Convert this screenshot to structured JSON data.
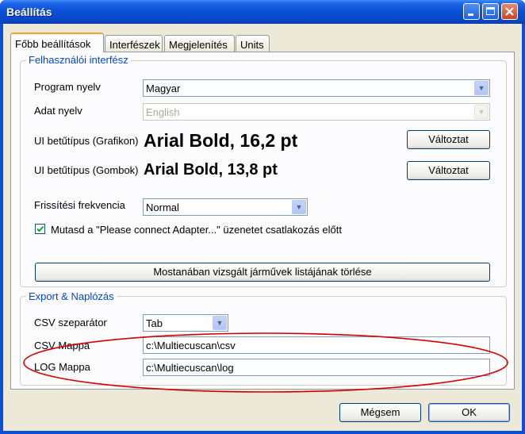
{
  "window": {
    "title": "Beállítás"
  },
  "tabs": [
    {
      "label": "Főbb beállítások",
      "active": true
    },
    {
      "label": "Interfészek",
      "active": false
    },
    {
      "label": "Megjelenítés",
      "active": false
    },
    {
      "label": "Units",
      "active": false
    }
  ],
  "ui_group": {
    "title": "Felhasználói interfész",
    "program_language": {
      "label": "Program nyelv",
      "value": "Magyar"
    },
    "data_language": {
      "label": "Adat nyelv",
      "value": "English",
      "disabled": true
    },
    "font_chart": {
      "label": "UI betűtípus (Grafikon)",
      "preview": "Arial Bold, 16,2 pt",
      "button": "Változtat"
    },
    "font_buttons": {
      "label": "UI betűtípus (Gombok)",
      "preview": "Arial Bold, 13,8 pt",
      "button": "Változtat"
    },
    "refresh": {
      "label": "Frissítési frekvencia",
      "value": "Normal"
    },
    "adapter_check": {
      "label": "Mutasd a \"Please connect Adapter...\" üzenetet csatlakozás előtt",
      "checked": true
    },
    "clear_button": "Mostanában vizsgált járművek listájának törlése"
  },
  "export_group": {
    "title": "Export & Naplózás",
    "csv_separator": {
      "label": "CSV szeparátor",
      "value": "Tab"
    },
    "csv_folder": {
      "label": "CSV Mappa",
      "value": "c:\\Multiecuscan\\csv"
    },
    "log_folder": {
      "label": "LOG Mappa",
      "value": "c:\\Multiecuscan\\log"
    }
  },
  "footer": {
    "cancel": "Mégsem",
    "ok": "OK"
  },
  "colors": {
    "accent": "#0a4fd6",
    "group_title": "#0046d5",
    "annotation": "#d40000",
    "check": "#21a121"
  }
}
